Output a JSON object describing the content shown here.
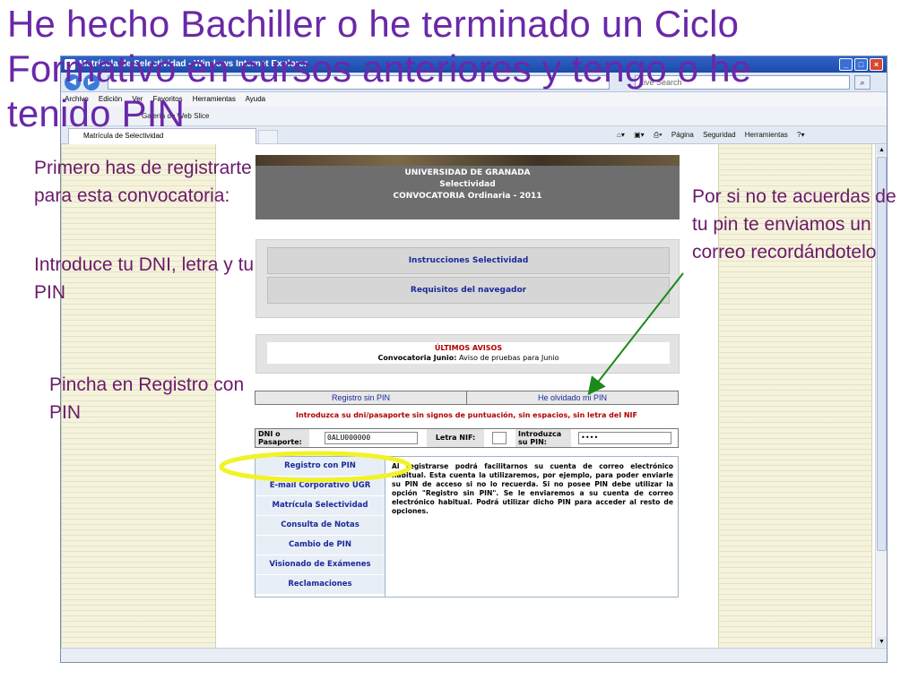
{
  "slide": {
    "title": "He hecho Bachiller o he terminado un Ciclo Formativo en cursos anteriores y tengo o he tenido PIN",
    "note_left_1": "Primero has de registrarte para esta convocatoria:",
    "note_left_2": "Introduce tu DNI, letra y tu PIN",
    "note_left_3": "Pincha en Registro con PIN",
    "note_right": "Por si no te acuerdas de tu pin te enviamos un correo recordándotelo",
    "arrow_color": "#1a8a1a",
    "highlight_color": "#f2f227",
    "text_color": "#6a28a8"
  },
  "browser": {
    "window_title": "Matrícula de Selectividad - Windows Internet Explorer",
    "search_placeholder": "Live Search",
    "menu": [
      "Archivo",
      "Edición",
      "Ver",
      "Favoritos",
      "Herramientas",
      "Ayuda"
    ],
    "favorites_label": "Favoritos",
    "favorites_item": "Galería de Web Slice",
    "tab_title": "Matrícula de Selectividad",
    "commands": [
      "Página",
      "Seguridad",
      "Herramientas"
    ]
  },
  "page": {
    "header": {
      "line1": "UNIVERSIDAD DE GRANADA",
      "line2": "Selectividad",
      "line3": "CONVOCATORIA Ordinaria - 2011"
    },
    "links": {
      "instrucciones": "Instrucciones Selectividad",
      "requisitos": "Requisitos del navegador"
    },
    "avisos": {
      "title": "ÚLTIMOS AVISOS",
      "label": "Convocatoria Junio:",
      "text": "Aviso de pruebas para Junio"
    },
    "pin_tabs": {
      "registro_sin_pin": "Registro sin PIN",
      "olvidado_pin": "He olvidado mi PIN"
    },
    "instruction": "Introduzca su dni/pasaporte sin signos de puntuación, sin espacios, sin letra del NIF",
    "login": {
      "dni_label": "DNI o Pasaporte:",
      "dni_value": "0ALU000000",
      "nif_label": "Letra NIF:",
      "nif_value": "",
      "pin_label": "Introduzca su PIN:",
      "pin_value": "••••"
    },
    "menu_items": [
      "Registro con PIN",
      "E-mail Corporativo UGR",
      "Matrícula Selectividad",
      "Consulta de Notas",
      "Cambio de PIN",
      "Visionado de Exámenes",
      "Reclamaciones"
    ],
    "description": "Al registrarse podrá facilitarnos su cuenta de correo electrónico habitual. Esta cuenta la utilizaremos, por ejemplo, para poder enviarle su PIN de acceso si no lo recuerda. Si no posee PIN debe utilizar la opción \"Registro sin PIN\". Se le enviaremos a su cuenta de correo electrónico habitual. Podrá utilizar dicho PIN para acceder al resto de opciones."
  }
}
